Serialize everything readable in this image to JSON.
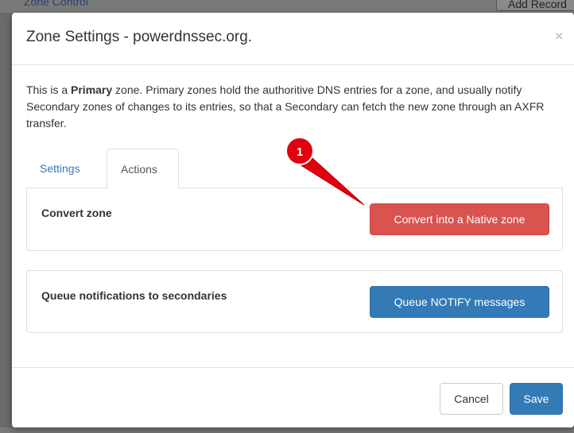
{
  "background": {
    "link_text": "Zone Control",
    "button_text": "Add Record"
  },
  "modal": {
    "title": "Zone Settings - powerdnssec.org.",
    "close_glyph": "×",
    "description_prefix": "This is a ",
    "description_bold": "Primary",
    "description_rest": " zone. Primary zones hold the authoritive DNS entries for a zone, and usually notify Secondary zones of changes to its entries, so that a Secondary can fetch the new zone through an AXFR transfer.",
    "tabs": [
      {
        "label": "Settings",
        "active": false
      },
      {
        "label": "Actions",
        "active": true
      }
    ],
    "actions": {
      "convert_label": "Convert zone",
      "convert_button": "Convert into a Native zone",
      "notify_label": "Queue notifications to secondaries",
      "notify_button": "Queue NOTIFY messages"
    },
    "footer": {
      "cancel_label": "Cancel",
      "save_label": "Save"
    }
  },
  "annotation": {
    "marker_number": "1",
    "color": "#e0000f"
  },
  "colors": {
    "primary": "#337ab7",
    "danger": "#d9534f",
    "link": "#337ab7"
  }
}
